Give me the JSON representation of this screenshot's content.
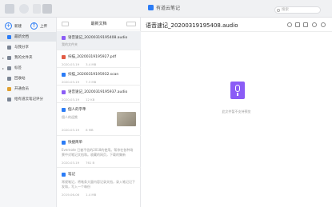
{
  "window": {
    "title": "有道云笔记"
  },
  "search": {
    "placeholder": "搜索"
  },
  "sidebar": {
    "new_label": "新建",
    "upload_label": "上传",
    "items": [
      {
        "label": "最新文档",
        "icon": "clock-icon",
        "active": true
      },
      {
        "label": "与我分享",
        "icon": "share-icon"
      },
      {
        "label": "我的文件夹",
        "icon": "folder-icon",
        "expandable": true
      },
      {
        "label": "标签",
        "icon": "tag-icon",
        "expandable": true
      },
      {
        "label": "回收站",
        "icon": "trash-icon"
      },
      {
        "label": "开通会员",
        "icon": "vip-icon"
      },
      {
        "label": "给有道云笔记评分",
        "icon": "star-icon"
      }
    ]
  },
  "list": {
    "header": "最新文档",
    "notes": [
      {
        "title": "语音速记_20200319195408.audio",
        "sub": "我的文件夹",
        "meta_date": "",
        "meta_size": "",
        "icon_color": "#8b5cf6",
        "selected": true
      },
      {
        "title": "扫描_20200319195927.pdf",
        "sub": "",
        "meta_date": "2020-03-19",
        "meta_size": "3.4 MB",
        "icon_color": "#e25b45"
      },
      {
        "title": "扫描_20200319195932.scan",
        "sub": "",
        "meta_date": "2020-03-19",
        "meta_size": "7.3 MB",
        "icon_color": "#2b7cf6"
      },
      {
        "title": "语音速记_20200319195937.audio",
        "sub": "",
        "meta_date": "2020-03-19",
        "meta_size": "12 KB",
        "icon_color": "#8b5cf6"
      },
      {
        "title": "個人的字準",
        "sub": "個人的迎獎",
        "meta_date": "2020-03-19",
        "meta_size": "8 MB",
        "icon_color": "#2b7cf6",
        "thumb": true
      },
      {
        "title": "快捷简单",
        "sub": "Evernote 已被不信的2018的使用。帮你在各种场景中对笔记文档和。收藏的网页，下载的集新",
        "meta_date": "2020-03-19",
        "meta_size": "761 B",
        "icon_color": "#2b7cf6"
      },
      {
        "title": "笔记",
        "sub": "常规笔记，将笔条大量内容记录文档，录入笔记记下发和，写入一个每份",
        "meta_date": "2019-06-06",
        "meta_size": "1.4 MB",
        "icon_color": "#2b7cf6"
      }
    ]
  },
  "main": {
    "title": "语音速记_20200319195408.audio",
    "message": "此文件暂不支持预览"
  }
}
